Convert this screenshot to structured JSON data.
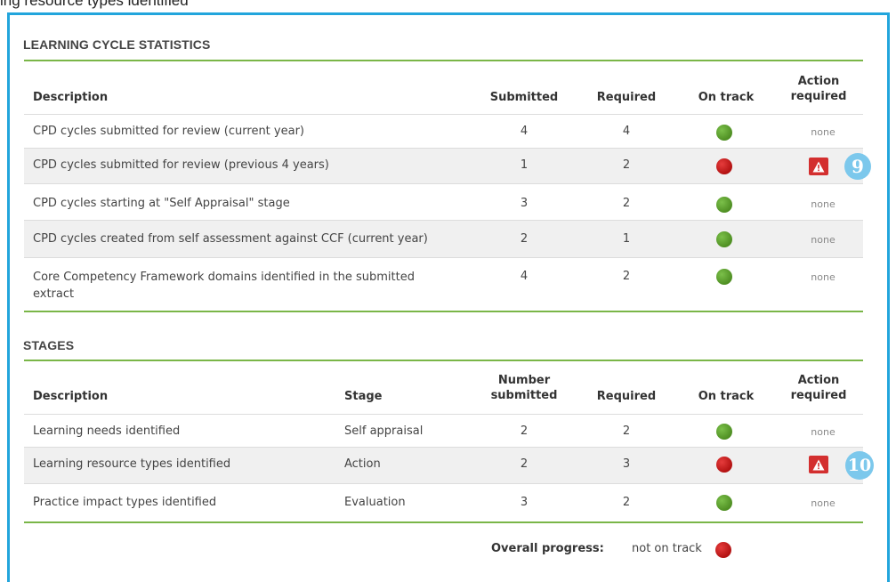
{
  "caption": "ing resource types identified",
  "learning_cycle": {
    "title": "LEARNING CYCLE STATISTICS",
    "headers": {
      "description": "Description",
      "submitted": "Submitted",
      "required": "Required",
      "on_track": "On track",
      "action_line1": "Action",
      "action_line2": "required"
    },
    "rows": [
      {
        "description": "CPD cycles submitted for review (current year)",
        "submitted": "4",
        "required": "4",
        "on_track": "green",
        "action": "none"
      },
      {
        "description": "CPD cycles submitted for review (previous 4 years)",
        "submitted": "1",
        "required": "2",
        "on_track": "red",
        "action": "warning",
        "badge": "9"
      },
      {
        "description": "CPD cycles starting at \"Self Appraisal\" stage",
        "submitted": "3",
        "required": "2",
        "on_track": "green",
        "action": "none"
      },
      {
        "description": "CPD cycles created from self assessment against CCF (current year)",
        "submitted": "2",
        "required": "1",
        "on_track": "green",
        "action": "none"
      },
      {
        "description": "Core Competency Framework domains identified in the submitted extract",
        "submitted": "4",
        "required": "2",
        "on_track": "green",
        "action": "none"
      }
    ]
  },
  "stages": {
    "title": "STAGES",
    "headers": {
      "description": "Description",
      "stage": "Stage",
      "number_line1": "Number",
      "number_line2": "submitted",
      "required": "Required",
      "on_track": "On track",
      "action_line1": "Action",
      "action_line2": "required"
    },
    "rows": [
      {
        "description": "Learning needs identified",
        "stage": "Self appraisal",
        "submitted": "2",
        "required": "2",
        "on_track": "green",
        "action": "none"
      },
      {
        "description": "Learning resource types identified",
        "stage": "Action",
        "submitted": "2",
        "required": "3",
        "on_track": "red",
        "action": "warning",
        "badge": "10"
      },
      {
        "description": "Practice impact types identified",
        "stage": "Evaluation",
        "submitted": "3",
        "required": "2",
        "on_track": "green",
        "action": "none"
      }
    ]
  },
  "overall": {
    "label": "Overall progress:",
    "value": "not on track",
    "status": "red"
  },
  "colors": {
    "frame": "#22a5dc",
    "divider": "#7ab648",
    "on_track_green": "#5a9e2f",
    "off_track_red": "#c81e1e",
    "warning": "#d32f2f",
    "badge": "#7cc8ec"
  }
}
